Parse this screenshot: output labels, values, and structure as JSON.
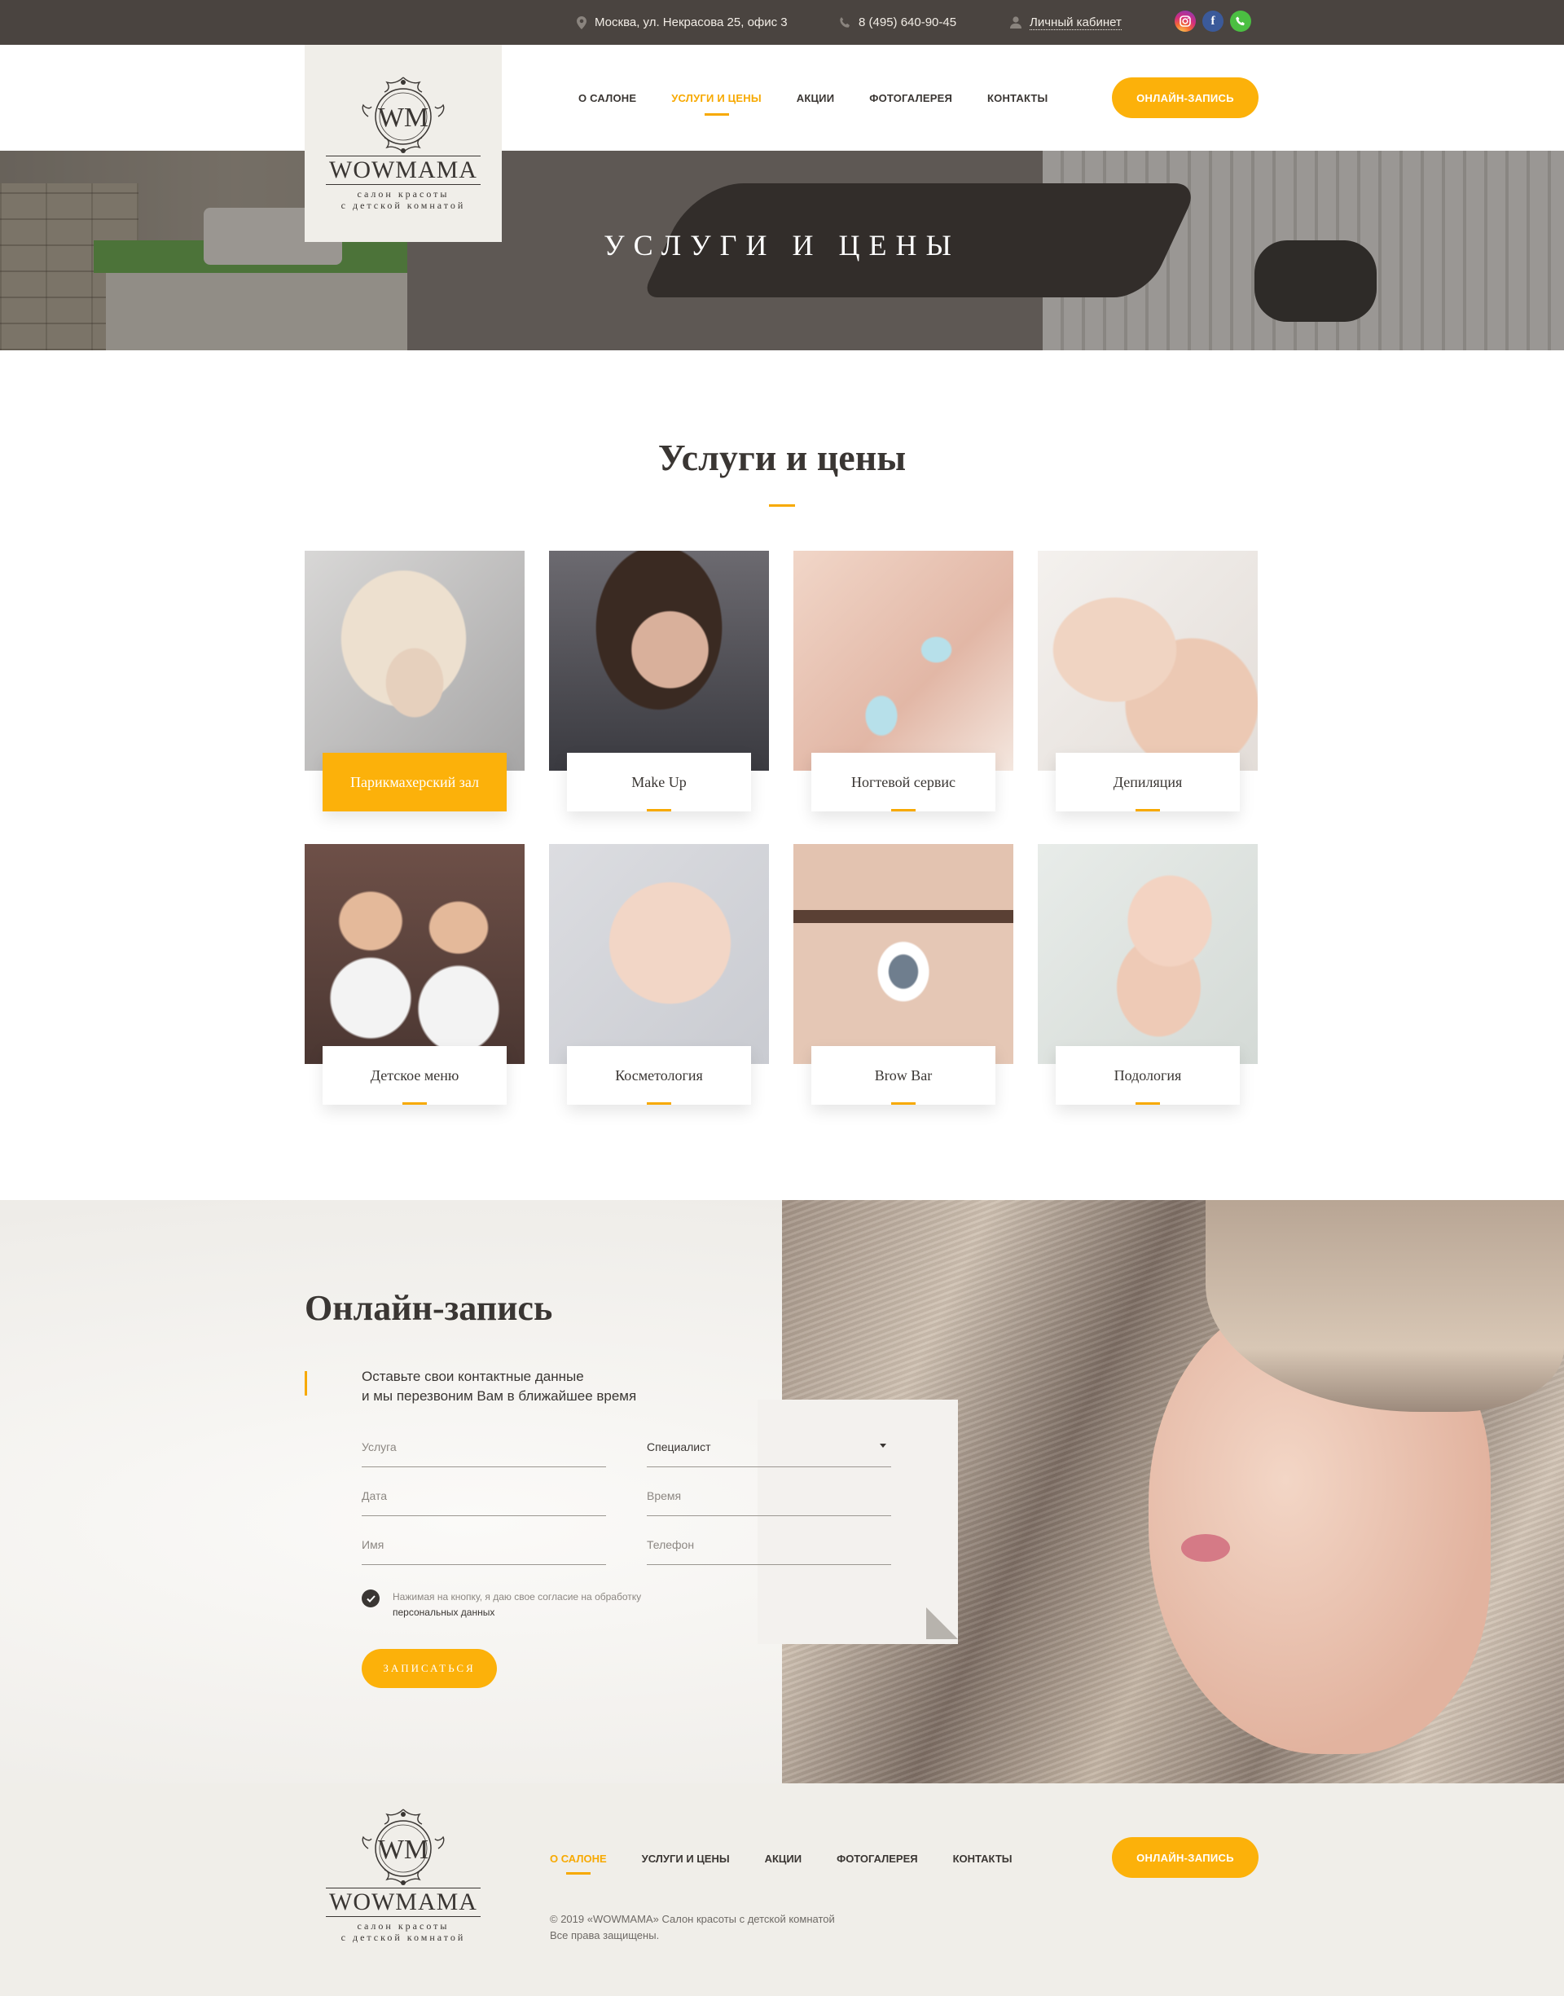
{
  "topbar": {
    "address": "Москва, ул. Некрасова 25, офис 3",
    "phone": "8 (495) 640-90-45",
    "cabinet": "Личный кабинет",
    "socials": [
      {
        "name": "instagram-icon",
        "glyph": "◎"
      },
      {
        "name": "facebook-icon",
        "glyph": "f"
      },
      {
        "name": "whatsapp-icon",
        "glyph": "✆"
      }
    ]
  },
  "logo": {
    "monogram": "WM",
    "brand": "WOWMAMA",
    "tagline_1": "салон красоты",
    "tagline_2": "с детской комнатой"
  },
  "nav": {
    "items": [
      {
        "label": "О САЛОНЕ"
      },
      {
        "label": "УСЛУГИ И ЦЕНЫ",
        "active": true
      },
      {
        "label": "АКЦИИ"
      },
      {
        "label": "ФОТОГАЛЕРЕЯ"
      },
      {
        "label": "КОНТАКТЫ"
      }
    ],
    "cta": "ОНЛАЙН-ЗАПИСЬ"
  },
  "hero": {
    "title": "УСЛУГИ И ЦЕНЫ"
  },
  "services": {
    "title": "Услуги и цены",
    "items": [
      {
        "label": "Парикмахерский зал",
        "active": true
      },
      {
        "label": "Make Up"
      },
      {
        "label": "Ногтевой сервис"
      },
      {
        "label": "Депиляция"
      },
      {
        "label": "Детское меню"
      },
      {
        "label": "Косметология"
      },
      {
        "label": "Brow Bar"
      },
      {
        "label": "Подология"
      }
    ]
  },
  "booking": {
    "title": "Онлайн-запись",
    "lead_1": "Оставьте свои контактные данные",
    "lead_2": "и мы перезвоним Вам в ближайшее время",
    "fields": {
      "service_placeholder": "Услуга",
      "specialist_value": "Специалист",
      "date_placeholder": "Дата",
      "time_placeholder": "Время",
      "name_placeholder": "Имя",
      "phone_placeholder": "Телефон"
    },
    "consent_1": "Нажимая на кнопку, я даю свое согласие на обработку",
    "consent_2": "персональных данных",
    "submit": "ЗАПИСАТЬСЯ"
  },
  "footer": {
    "nav": [
      {
        "label": "О САЛОНЕ",
        "active": true
      },
      {
        "label": "УСЛУГИ И ЦЕНЫ"
      },
      {
        "label": "АКЦИИ"
      },
      {
        "label": "ФОТОГАЛЕРЕЯ"
      },
      {
        "label": "КОНТАКТЫ"
      }
    ],
    "cta": "ОНЛАЙН-ЗАПИСЬ",
    "copyright_1": "© 2019 «WOWMAMA» Салон красоты с детской комнатой",
    "copyright_2": "Все права защищены."
  },
  "colors": {
    "accent": "#fcb10a",
    "topbar": "#4a4440",
    "text": "#3a3633"
  }
}
